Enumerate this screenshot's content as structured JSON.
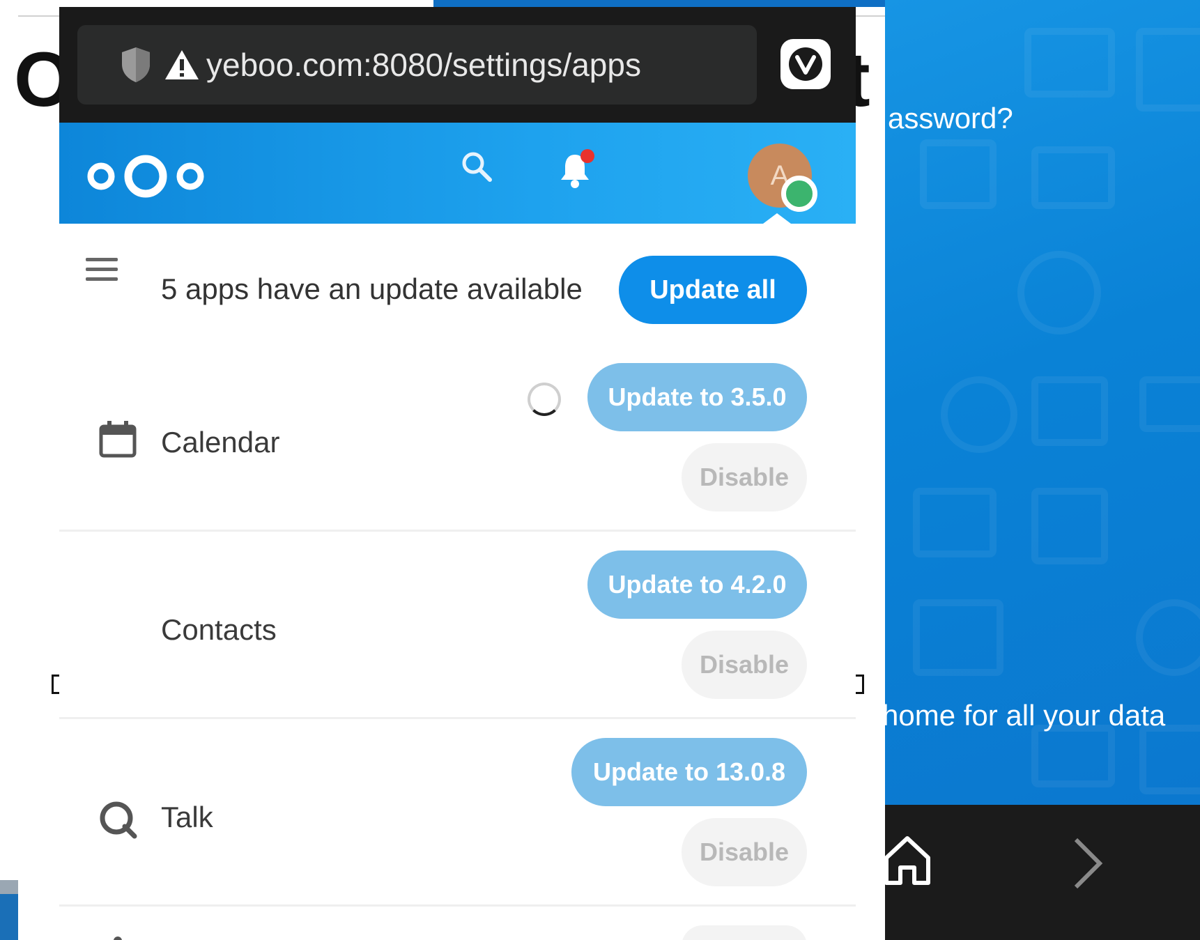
{
  "browser": {
    "url": "yeboo.com:8080/settings/apps"
  },
  "updates": {
    "notice": "5 apps have an update available",
    "update_all_label": "Update all"
  },
  "apps": [
    {
      "name": "Calendar",
      "update_label": "Update to 3.5.0",
      "disable_label": "Disable",
      "icon": "calendar-icon"
    },
    {
      "name": "Contacts",
      "update_label": "Update to 4.2.0",
      "disable_label": "Disable",
      "icon": "none"
    },
    {
      "name": "Talk",
      "update_label": "Update to 13.0.8",
      "disable_label": "Disable",
      "icon": "talk-icon"
    }
  ],
  "background": {
    "password_text": "assword?",
    "tagline_text": "home for all your data",
    "big_left_glyph": "O",
    "big_right_glyph": "t"
  },
  "colors": {
    "header_blue": "#0d86d9",
    "primary_button": "#0e8ee9",
    "update_button_faded": "#7dbfe9",
    "status_online": "#3cb46e",
    "notification_dot": "#e9322d",
    "avatar": "#c88a5d"
  }
}
